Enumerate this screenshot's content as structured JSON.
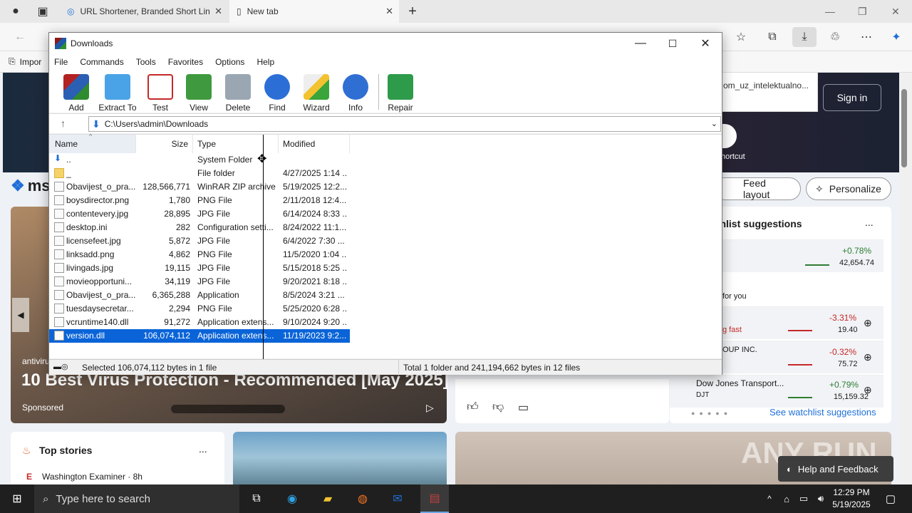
{
  "browser": {
    "tabs": [
      {
        "label": "URL Shortener, Branded Short Lin"
      },
      {
        "label": "New tab"
      }
    ],
    "fav_first": "Impor"
  },
  "msn": {
    "brand": "ms",
    "sign_in": "Sign in",
    "suggestion_text": "om_uz_intelektualno...",
    "shortcut_label": "hortcut",
    "feed_layout": "Feed layout",
    "personalize": "Personalize",
    "ad_small": "antiviru",
    "ad_title": "10 Best Virus Protection - Recommended [May 2025]",
    "ad_sponsor": "Sponsored",
    "watchlist_title": "tchlist suggestions",
    "watchlist_more": "...",
    "for_you": "for you",
    "going_fast": "g fast",
    "stocks": [
      {
        "name": "",
        "change": "+0.78%",
        "price": "42,654.74",
        "color": "#2e7d32"
      },
      {
        "name": "",
        "change": "-3.31%",
        "price": "19.40",
        "color": "#c62828"
      },
      {
        "name": "OUP INC.",
        "change": "-0.32%",
        "price": "75.72",
        "color": "#c62828"
      },
      {
        "name": "Dow Jones Transport...",
        "sub": "DJT",
        "change": "+0.79%",
        "price": "15,159.32",
        "color": "#2e7d32"
      }
    ],
    "see_watchlist": "See watchlist suggestions",
    "top_stories": "Top stories",
    "top_more": "...",
    "source": "Washington Examiner · 8h",
    "help_feedback": "Help and Feedback",
    "watermark": "ANY RUN"
  },
  "winrar": {
    "title": "Downloads",
    "menu": [
      "File",
      "Commands",
      "Tools",
      "Favorites",
      "Options",
      "Help"
    ],
    "toolbar": [
      "Add",
      "Extract To",
      "Test",
      "View",
      "Delete",
      "Find",
      "Wizard",
      "Info",
      "Repair"
    ],
    "path": "C:\\Users\\admin\\Downloads",
    "columns": {
      "name": "Name",
      "size": "Size",
      "type": "Type",
      "modified": "Modified"
    },
    "files": [
      {
        "name": "..",
        "size": "",
        "type": "System Folder",
        "modified": ""
      },
      {
        "name": "_",
        "size": "",
        "type": "File folder",
        "modified": "4/27/2025 1:14 ..."
      },
      {
        "name": "Obavijest_o_pra...",
        "size": "128,566,771",
        "type": "WinRAR ZIP archive",
        "modified": "5/19/2025 12:2..."
      },
      {
        "name": "boysdirector.png",
        "size": "1,780",
        "type": "PNG File",
        "modified": "2/11/2018 12:4..."
      },
      {
        "name": "contentevery.jpg",
        "size": "28,895",
        "type": "JPG File",
        "modified": "6/14/2024 8:33 ..."
      },
      {
        "name": "desktop.ini",
        "size": "282",
        "type": "Configuration setti...",
        "modified": "8/24/2022 11:1..."
      },
      {
        "name": "licensefeet.jpg",
        "size": "5,872",
        "type": "JPG File",
        "modified": "6/4/2022 7:30 ..."
      },
      {
        "name": "linksadd.png",
        "size": "4,862",
        "type": "PNG File",
        "modified": "11/5/2020 1:04 ..."
      },
      {
        "name": "livingads.jpg",
        "size": "19,115",
        "type": "JPG File",
        "modified": "5/15/2018 5:25 ..."
      },
      {
        "name": "movieopportuni...",
        "size": "34,119",
        "type": "JPG File",
        "modified": "9/20/2021 8:18 ..."
      },
      {
        "name": "Obavijest_o_pra...",
        "size": "6,365,288",
        "type": "Application",
        "modified": "8/5/2024 3:21 ..."
      },
      {
        "name": "tuesdaysecretar...",
        "size": "2,294",
        "type": "PNG File",
        "modified": "5/25/2020 6:28 ..."
      },
      {
        "name": "vcruntime140.dll",
        "size": "91,272",
        "type": "Application extens...",
        "modified": "9/10/2024 9:20 ..."
      },
      {
        "name": "version.dll",
        "size": "106,074,112",
        "type": "Application extens...",
        "modified": "11/19/2023 9:2..."
      }
    ],
    "status_left": "Selected 106,074,112 bytes in 1 file",
    "status_right": "Total 1 folder and 241,194,662 bytes in 12 files"
  },
  "taskbar": {
    "search_placeholder": "Type here to search",
    "time": "12:29 PM",
    "date": "5/19/2025"
  }
}
